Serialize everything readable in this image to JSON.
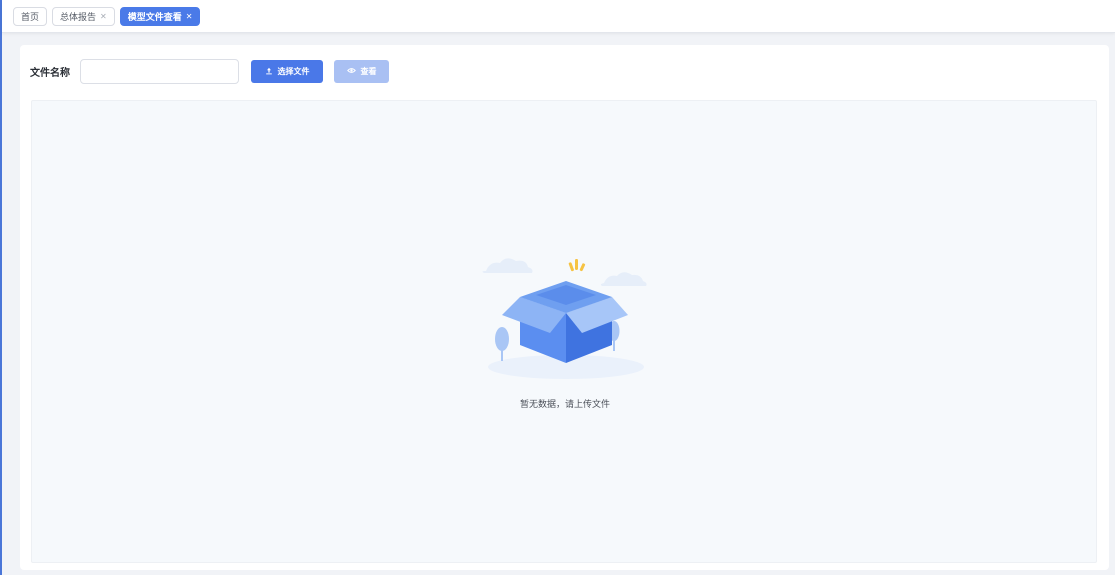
{
  "tabs": [
    {
      "label": "首页",
      "closable": false,
      "active": false
    },
    {
      "label": "总体报告",
      "closable": true,
      "active": false
    },
    {
      "label": "模型文件查看",
      "closable": true,
      "active": true
    }
  ],
  "toolbar": {
    "file_name_label": "文件名称",
    "file_name_value": "",
    "select_button_label": "选择文件",
    "select_button_icon": "upload-icon",
    "view_button_label": "查看",
    "view_button_icon": "eye-icon"
  },
  "empty_state": {
    "icon": "empty-box-illustration",
    "message": "暂无数据，请上传文件"
  },
  "colors": {
    "accent": "#4a78e8",
    "disabled": "#a9c0f3"
  }
}
